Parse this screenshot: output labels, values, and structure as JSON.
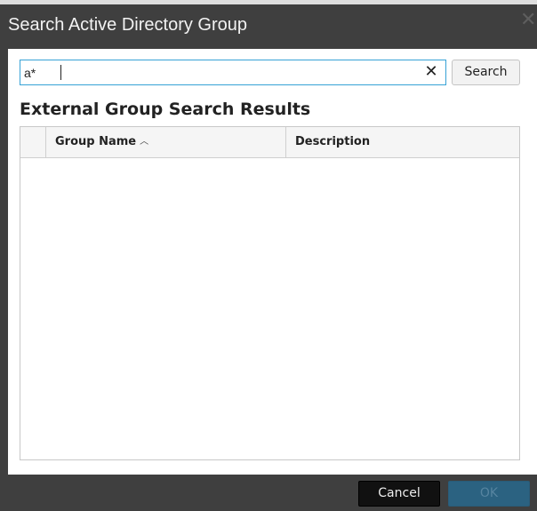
{
  "dialog": {
    "title": "Search Active Directory Group",
    "close_icon": "close-icon"
  },
  "search": {
    "value": "a*",
    "clear_icon": "clear-icon",
    "button_label": "Search"
  },
  "results": {
    "heading": "External Group Search Results",
    "columns": [
      {
        "label": "Group Name",
        "sorted": "ascending"
      },
      {
        "label": "Description"
      }
    ],
    "sort_icon": "sort-ascending-icon",
    "rows": []
  },
  "footer": {
    "cancel_label": "Cancel",
    "ok_label": "OK",
    "ok_enabled": false
  },
  "colors": {
    "chrome": "#3f3f3f",
    "input_focus_border": "#36a2d6",
    "ok_disabled_bg": "#2b6281"
  }
}
